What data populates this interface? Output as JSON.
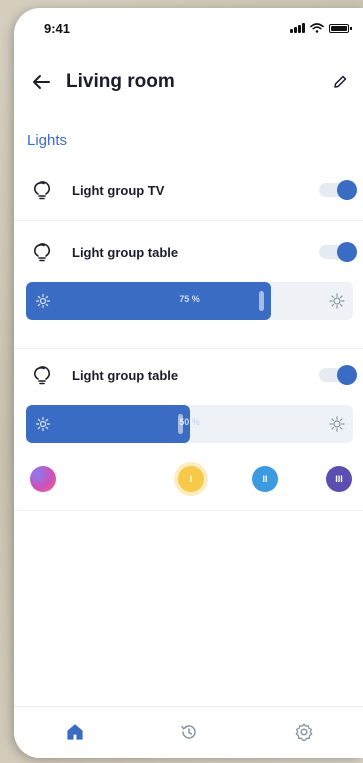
{
  "status_bar": {
    "time": "9:41"
  },
  "header": {
    "title": "Living room"
  },
  "section": {
    "title": "Lights"
  },
  "light_groups": [
    {
      "name": "Light group TV",
      "on": true
    },
    {
      "name": "Light group table",
      "on": true,
      "brightness": 75,
      "brightness_label": "75 %"
    },
    {
      "name": "Light group table",
      "on": true,
      "brightness": 50,
      "brightness_label": "50 %"
    }
  ],
  "scenes": [
    {
      "name": "gradient-scene",
      "label": ""
    },
    {
      "name": "scene-I",
      "label": "I"
    },
    {
      "name": "scene-II",
      "label": "II"
    },
    {
      "name": "scene-III",
      "label": "III"
    }
  ],
  "tabbar": {
    "items": [
      {
        "icon": "home-icon",
        "active": true
      },
      {
        "icon": "history-icon",
        "active": false
      },
      {
        "icon": "settings-icon",
        "active": false
      }
    ]
  },
  "colors": {
    "accent": "#3b6cc4",
    "section_title": "#3a6cc9",
    "scene_yellow": "#f7c948",
    "scene_cyan": "#3c9be0",
    "scene_purple": "#5a4fb0"
  }
}
